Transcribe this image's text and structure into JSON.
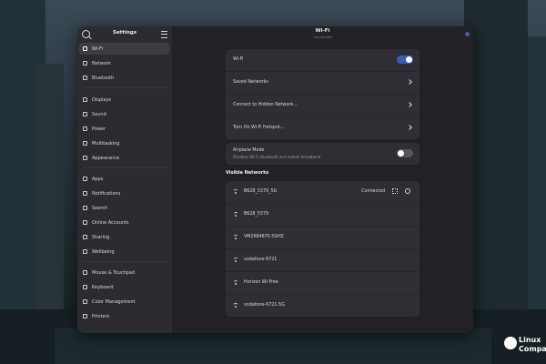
{
  "sidebar": {
    "title": "Settings",
    "items": [
      {
        "label": "Wi-Fi",
        "icon": "wifi-icon",
        "active": true
      },
      {
        "label": "Network",
        "icon": "network-icon"
      },
      {
        "label": "Bluetooth",
        "icon": "bluetooth-icon"
      },
      {
        "label": "Displays",
        "icon": "display-icon"
      },
      {
        "label": "Sound",
        "icon": "sound-icon"
      },
      {
        "label": "Power",
        "icon": "power-icon"
      },
      {
        "label": "Multitasking",
        "icon": "multitasking-icon"
      },
      {
        "label": "Appearance",
        "icon": "appearance-icon"
      },
      {
        "label": "Apps",
        "icon": "apps-icon"
      },
      {
        "label": "Notifications",
        "icon": "bell-icon"
      },
      {
        "label": "Search",
        "icon": "search-icon"
      },
      {
        "label": "Online Accounts",
        "icon": "accounts-icon"
      },
      {
        "label": "Sharing",
        "icon": "share-icon"
      },
      {
        "label": "Wellbeing",
        "icon": "wellbeing-icon"
      },
      {
        "label": "Mouse & Touchpad",
        "icon": "mouse-icon"
      },
      {
        "label": "Keyboard",
        "icon": "keyboard-icon"
      },
      {
        "label": "Color Management",
        "icon": "color-icon"
      },
      {
        "label": "Printers",
        "icon": "printer-icon"
      }
    ]
  },
  "header": {
    "title": "Wi-Fi",
    "subtitle": "Connected"
  },
  "wifi_card": {
    "wifi_label": "Wi-Fi",
    "wifi_on": true,
    "saved_networks": "Saved Networks",
    "hidden_network": "Connect to Hidden Network...",
    "hotspot": "Turn On Wi-Fi Hotspot..."
  },
  "airplane": {
    "label": "Airplane Mode",
    "sublabel": "Disables Wi-Fi, Bluetooth and mobile broadband",
    "on": false
  },
  "visible_networks": {
    "title": "Visible Networks",
    "networks": [
      {
        "name": "B628_5379_5G",
        "status": "Connected"
      },
      {
        "name": "B628_5379",
        "status": ""
      },
      {
        "name": "VM2684870 5GHZ",
        "status": ""
      },
      {
        "name": "vodafone-6721",
        "status": ""
      },
      {
        "name": "Horizon Wi-Free",
        "status": ""
      },
      {
        "name": "vodafone-6721-5G",
        "status": ""
      }
    ]
  },
  "watermark": {
    "line1": "Linux",
    "line2": "Compat"
  },
  "colors": {
    "accent": "#3a5eb7",
    "window_bg": "#222226",
    "sidebar_bg": "#2b2b30",
    "card_bg": "#2e2e34"
  }
}
